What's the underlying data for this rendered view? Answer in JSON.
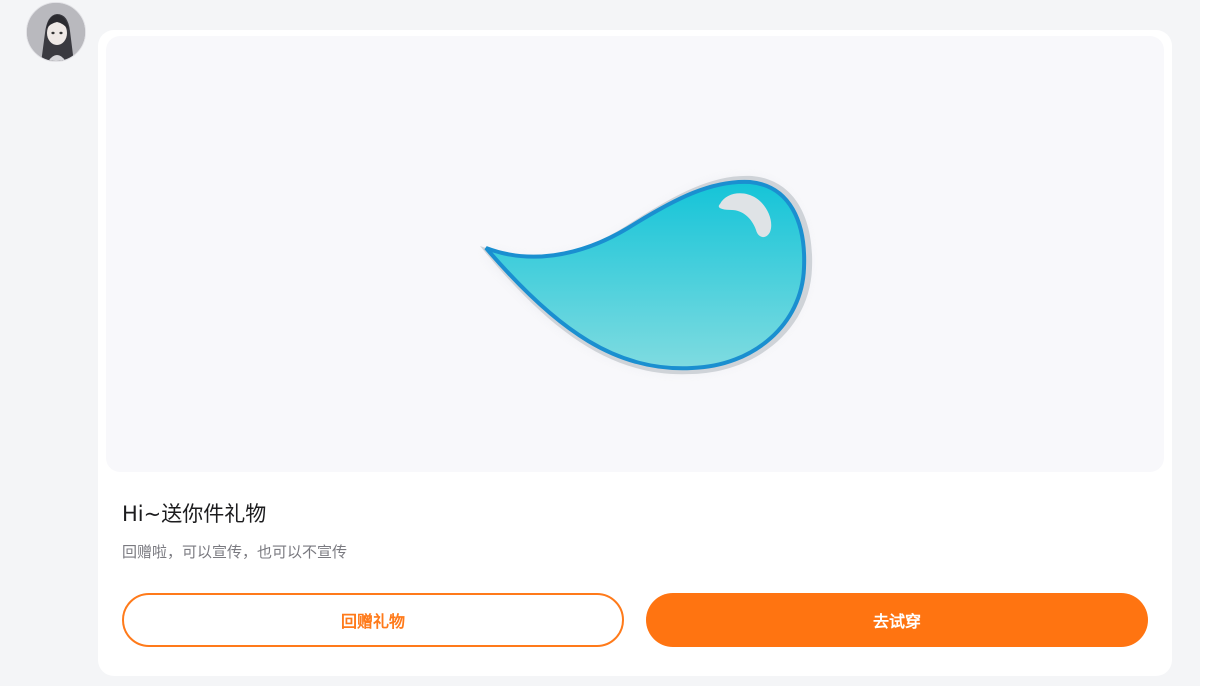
{
  "sender": {
    "avatar_icon": "user-avatar"
  },
  "gift": {
    "image_icon": "water-drop-icon",
    "accent_color": "#27c2d8",
    "title": "Hi~送你件礼物",
    "subtitle": "回赠啦，可以宣传，也可以不宣传"
  },
  "actions": {
    "return_gift_label": "回赠礼物",
    "try_on_label": "去试穿",
    "primary_color": "#ff7411"
  }
}
